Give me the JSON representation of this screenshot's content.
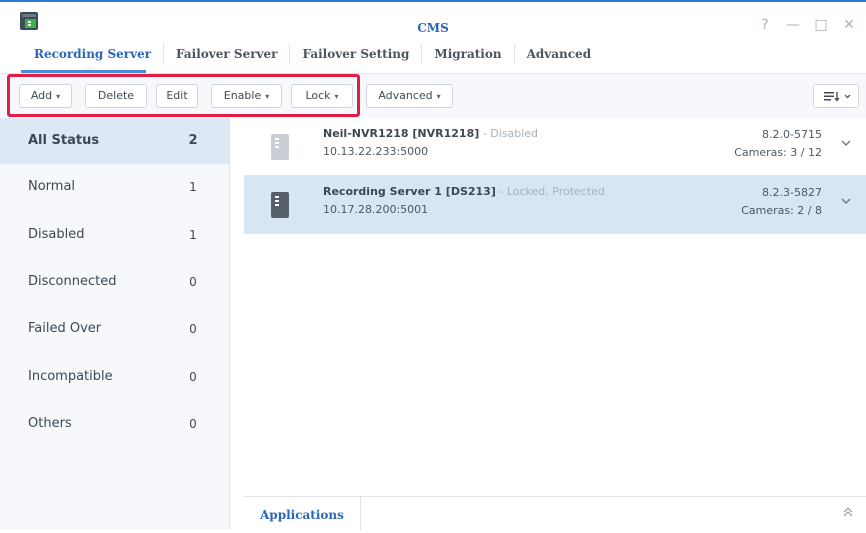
{
  "window": {
    "title": "CMS",
    "controls": {
      "help": "?",
      "minimize": "—",
      "maximize": "□",
      "close": "✕"
    }
  },
  "tabs": [
    {
      "label": "Recording Server",
      "active": true
    },
    {
      "label": "Failover Server",
      "active": false
    },
    {
      "label": "Failover Setting",
      "active": false
    },
    {
      "label": "Migration",
      "active": false
    },
    {
      "label": "Advanced",
      "active": false
    }
  ],
  "toolbar": {
    "add_label": "Add",
    "delete_label": "Delete",
    "edit_label": "Edit",
    "enable_label": "Enable",
    "lock_label": "Lock",
    "advanced_label": "Advanced",
    "caret": "▾",
    "view_icon": "≡↓"
  },
  "status_filters": [
    {
      "label": "All Status",
      "count": "2",
      "active": true
    },
    {
      "label": "Normal",
      "count": "1"
    },
    {
      "label": "Disabled",
      "count": "1"
    },
    {
      "label": "Disconnected",
      "count": "0"
    },
    {
      "label": "Failed Over",
      "count": "0"
    },
    {
      "label": "Incompatible",
      "count": "0"
    },
    {
      "label": "Others",
      "count": "0"
    }
  ],
  "servers": [
    {
      "name": "Neil-NVR1218 [NVR1218]",
      "state": " - Disabled",
      "address": "10.13.22.233:5000",
      "version": "8.2.0-5715",
      "cameras": "Cameras: 3 / 12",
      "icon_color": "#c9ced4",
      "selected": false
    },
    {
      "name": "Recording Server 1 [DS213]",
      "state": " - Locked, Protected",
      "address": "10.17.28.200:5001",
      "version": "8.2.3-5827",
      "cameras": "Cameras: 2 / 8",
      "icon_color": "#55606b",
      "selected": true
    }
  ],
  "bottom": {
    "applications_label": "Applications",
    "expand_icon": "≈"
  },
  "colors": {
    "accent": "#2a67b8",
    "highlight_border": "#e01e47",
    "selected_row": "#d6e6f3"
  }
}
